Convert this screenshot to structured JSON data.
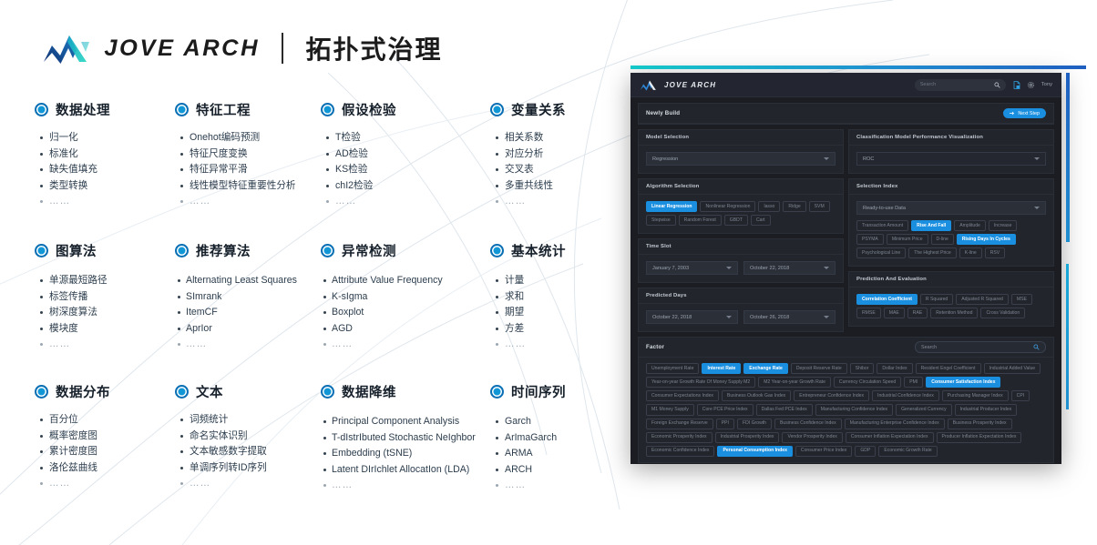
{
  "header": {
    "brand": "JOVE ARCH",
    "title": "拓扑式治理"
  },
  "categories": [
    {
      "title": "数据处理",
      "items": [
        "归一化",
        "标准化",
        "缺失值填充",
        "类型转换",
        "……"
      ]
    },
    {
      "title": "特征工程",
      "items": [
        "Onehot编码预测",
        "特征尺度变换",
        "特征异常平滑",
        "线性模型特征重要性分析",
        "……"
      ]
    },
    {
      "title": "假设检验",
      "items": [
        "T检验",
        "AD检验",
        "KS检验",
        "chI2检验",
        "……"
      ]
    },
    {
      "title": "变量关系",
      "items": [
        "相关系数",
        "对应分析",
        "交叉表",
        "多重共线性",
        "……"
      ]
    },
    {
      "title": "图算法",
      "items": [
        "单源最短路径",
        "标签传播",
        "树深度算法",
        "模块度",
        "……"
      ]
    },
    {
      "title": "推荐算法",
      "items": [
        "Alternating Least Squares",
        "SImrank",
        "ItemCF",
        "AprIor",
        "……"
      ]
    },
    {
      "title": "异常检测",
      "items": [
        "Attribute Value Frequency",
        "K-sIgma",
        "Boxplot",
        "AGD",
        "……"
      ]
    },
    {
      "title": "基本统计",
      "items": [
        "计量",
        "求和",
        "期望",
        "方差",
        "……"
      ]
    },
    {
      "title": "数据分布",
      "items": [
        "百分位",
        "概率密度图",
        "累计密度图",
        "洛伦兹曲线",
        "……"
      ]
    },
    {
      "title": "文本",
      "items": [
        "词频统计",
        "命名实体识别",
        "文本敏感数字提取",
        "单调序列转ID序列",
        "……"
      ]
    },
    {
      "title": "数据降维",
      "items": [
        "Principal Component Analysis",
        "T-dIstrIbuted Stochastic NeIghbor",
        "Embedding (tSNE)",
        "Latent DIrIchlet AllocatIon (LDA)",
        "……"
      ]
    },
    {
      "title": "时间序列",
      "items": [
        "Garch",
        "ArImaGarch",
        "ARMA",
        "ARCH",
        "……"
      ]
    }
  ],
  "app": {
    "brand": "JOVE ARCH",
    "search_placeholder": "Search",
    "user": "Tony",
    "page": {
      "title": "Newly Build",
      "next_step": "Next Step"
    },
    "model_selection": {
      "title": "Model Selection",
      "value": "Regression"
    },
    "classification_viz": {
      "title": "Classification Model Performance Visualization",
      "value": "ROC"
    },
    "algorithm_selection": {
      "title": "Algorithm Selection",
      "tags": [
        {
          "label": "Linear Regression",
          "selected": true
        },
        {
          "label": "Nonlinear Regression",
          "selected": false
        },
        {
          "label": "lasso",
          "selected": false
        },
        {
          "label": "Ridge",
          "selected": false
        },
        {
          "label": "SVM",
          "selected": false
        },
        {
          "label": "Stepwise",
          "selected": false
        },
        {
          "label": "Random Forest",
          "selected": false
        },
        {
          "label": "GBDT",
          "selected": false
        },
        {
          "label": "Cart",
          "selected": false
        }
      ]
    },
    "selection_index": {
      "title": "Selection Index",
      "dropdown": "Ready-to-use Data",
      "tags": [
        {
          "label": "Transaction Amount",
          "selected": false
        },
        {
          "label": "Rise And Fall",
          "selected": true
        },
        {
          "label": "Amplitude",
          "selected": false
        },
        {
          "label": "Increase",
          "selected": false
        },
        {
          "label": "PSYMA",
          "selected": false
        },
        {
          "label": "Minimum Price",
          "selected": false
        },
        {
          "label": "D-line",
          "selected": false
        },
        {
          "label": "Rising Days In Cycles",
          "selected": true
        },
        {
          "label": "Psychological Line",
          "selected": false
        },
        {
          "label": "The Highest Price",
          "selected": false
        },
        {
          "label": "K-line",
          "selected": false
        },
        {
          "label": "RSV",
          "selected": false
        }
      ]
    },
    "time_slot": {
      "title": "Time Slot",
      "start": "January 7, 2003",
      "end": "October 22, 2018"
    },
    "prediction_evaluation": {
      "title": "Prediction And Evaluation",
      "tags": [
        {
          "label": "Correlation Coefficient",
          "selected": true
        },
        {
          "label": "R Squared",
          "selected": false
        },
        {
          "label": "Adjusted R Squared",
          "selected": false
        },
        {
          "label": "MSE",
          "selected": false
        },
        {
          "label": "RMSE",
          "selected": false
        },
        {
          "label": "MAE",
          "selected": false
        },
        {
          "label": "RAE",
          "selected": false
        },
        {
          "label": "Retention Method",
          "selected": false
        },
        {
          "label": "Cross Validation",
          "selected": false
        }
      ]
    },
    "predicted_days": {
      "title": "Predicted Days",
      "start": "October 22, 2018",
      "end": "October 26, 2018"
    },
    "factor": {
      "title": "Factor",
      "search_placeholder": "Search",
      "tags": [
        {
          "label": "Unemployment Rate",
          "selected": false
        },
        {
          "label": "Interest Rate",
          "selected": true
        },
        {
          "label": "Exchange Rate",
          "selected": true
        },
        {
          "label": "Deposit Reserve Rate",
          "selected": false
        },
        {
          "label": "Shibor",
          "selected": false
        },
        {
          "label": "Dollar Index",
          "selected": false
        },
        {
          "label": "Resident Engel Coefficient",
          "selected": false
        },
        {
          "label": "Industrial Added Value",
          "selected": false
        },
        {
          "label": "Year-on-year Growth Rate Of Money Supply M2",
          "selected": false
        },
        {
          "label": "M2 Year-on-year Growth Rate",
          "selected": false
        },
        {
          "label": "Currency Circulation Speed",
          "selected": false
        },
        {
          "label": "PMI",
          "selected": false
        },
        {
          "label": "Consumer Satisfaction Index",
          "selected": true
        },
        {
          "label": "Consumer Expectations Index",
          "selected": false
        },
        {
          "label": "Business Outlook Gas Index",
          "selected": false
        },
        {
          "label": "Entrepreneur Confidence Index",
          "selected": false
        },
        {
          "label": "Industrial Confidence Index",
          "selected": false
        },
        {
          "label": "Purchasing Manager Index",
          "selected": false
        },
        {
          "label": "CPI",
          "selected": false
        },
        {
          "label": "M1 Money Supply",
          "selected": false
        },
        {
          "label": "Core PCE Price Index",
          "selected": false
        },
        {
          "label": "Dallas Fed PCE Index",
          "selected": false
        },
        {
          "label": "Manufacturing Confidence Index",
          "selected": false
        },
        {
          "label": "Generalized Currency",
          "selected": false
        },
        {
          "label": "Industrial Producer Index",
          "selected": false
        },
        {
          "label": "Foreign Exchange Reserve",
          "selected": false
        },
        {
          "label": "PPI",
          "selected": false
        },
        {
          "label": "FDI Growth",
          "selected": false
        },
        {
          "label": "Business Confidence Index",
          "selected": false
        },
        {
          "label": "Manufacturing Enterprise Confidence Index",
          "selected": false
        },
        {
          "label": "Business Prosperity Index",
          "selected": false
        },
        {
          "label": "Economic Prosperity Index",
          "selected": false
        },
        {
          "label": "Industrial Prosperity Index",
          "selected": false
        },
        {
          "label": "Vendor Prosperity Index",
          "selected": false
        },
        {
          "label": "Consumer Inflation Expectation Index",
          "selected": false
        },
        {
          "label": "Producer Inflation Expectation Index",
          "selected": false
        },
        {
          "label": "Economic Confidence Index",
          "selected": false
        },
        {
          "label": "Personal Consumption Index",
          "selected": true
        },
        {
          "label": "Consumer Price Index",
          "selected": false
        },
        {
          "label": "GDP",
          "selected": false
        },
        {
          "label": "Economic Growth Rate",
          "selected": false
        }
      ]
    }
  },
  "colors": {
    "accent": "#1a8fe0",
    "accent_teal": "#14c8c8",
    "dot": "#1197d6",
    "panel_bg": "#1b1d22"
  }
}
